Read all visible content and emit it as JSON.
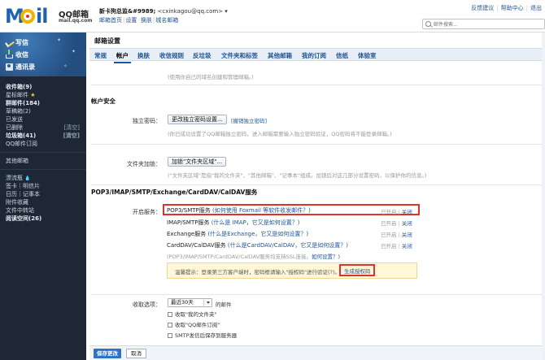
{
  "header": {
    "logo_text": "Mail",
    "logo_brand": "QQ邮箱",
    "logo_domain": "mail.qq.com",
    "user_name": "新卡狗总监&#9989;",
    "user_email": "<cxinkagou@qq.com>",
    "user_arrow": "▾",
    "links": [
      "邮箱首页",
      "设置",
      "换肤",
      "城名邮箱"
    ],
    "top_links": [
      "反馈建议",
      "帮助中心",
      "退出"
    ],
    "search_placeholder": "邮件搜索..."
  },
  "sidebar": {
    "write": "写信",
    "inbox": "收信",
    "contacts": "通讯录",
    "folders": [
      {
        "label": "收件箱(9)",
        "bold": true
      },
      {
        "label": "星标邮件",
        "star": "★"
      },
      {
        "label": "群邮件(184)",
        "bold": true
      },
      {
        "label": "草稿箱(2)"
      },
      {
        "label": "已发送"
      },
      {
        "label": "已删除",
        "clear": "[清空]"
      },
      {
        "label": "垃圾箱(41)",
        "bold": true,
        "clear": "[清空]"
      },
      {
        "label": "QQ邮件订阅"
      }
    ],
    "other_mailbox": "其他邮箱",
    "bottom_items": [
      {
        "label": "漂流瓶",
        "drop": "💧"
      },
      {
        "label": "签卡｜明信片"
      },
      {
        "label": "日历｜记事本"
      },
      {
        "label": "附件收藏"
      },
      {
        "label": "文件中转站"
      },
      {
        "label": "阅读空间(26)",
        "bold": true
      }
    ]
  },
  "main": {
    "title": "邮箱设置",
    "tabs": [
      "常规",
      "帐户",
      "换肤",
      "收信规则",
      "反垃圾",
      "文件夹和标签",
      "其他邮箱",
      "我的订阅",
      "信纸",
      "体验室"
    ],
    "active_tab": "帐户",
    "top_hint": "(使用你自己的域名创建和管理邮箱。)",
    "account_security": {
      "title": "帐户安全",
      "pw_label": "独立密码：",
      "pw_button": "更改独立密码设置...",
      "pw_link": "[撤销独立密码]",
      "pw_hint": "(你已成功设置了QQ邮箱独立密码，进入邮箱需要输入独立密码验证，QQ密码将不能登录邮箱。)"
    },
    "folder_password": {
      "label": "文件夹加锁：",
      "button": "加锁\"文件夹区域\"...",
      "hint": "(\"文件夹区域\"是指\"我的文件夹\"、\"其他邮箱\"、\"记事本\"组成。加锁后对这几部分设置密码，以保护你的信息。)"
    },
    "pop3": {
      "title": "POP3/IMAP/SMTP/Exchange/CardDAV/CalDAV服务",
      "label": "开启服务：",
      "services": [
        {
          "name": "POP3/SMTP服务",
          "help": "(如何使用 Foxmail 等软件收发邮件？)",
          "state": "已开启",
          "action": "关闭"
        },
        {
          "name": "IMAP/SMTP服务",
          "help": "(什么是 IMAP，它又是如何设置？)",
          "state": "已开启",
          "action": "关闭"
        },
        {
          "name": "Exchange服务",
          "help": "(什么是Exchange，它又是如何设置？)",
          "state": "已开启",
          "action": "关闭"
        },
        {
          "name": "CardDAV/CalDAV服务",
          "help": "(什么是CardDAV/CalDAV，它又是如何设置？)",
          "state": "已开启",
          "action": "关闭"
        }
      ],
      "ssl_hint": "(POP3/IMAP/SMTP/CardDAV/CalDAV服务均支持SSL连接。",
      "ssl_link": "如何设置？)",
      "warning_text": "温馨提示：登录第三方客户端时，密码框请输入\"授权码\"进行验证(?)。",
      "warning_link": "生成授权码"
    },
    "receive": {
      "label": "收取选项：",
      "select_value": "最近30天",
      "select_suffix": "的邮件",
      "options": [
        "收取\"我的文件夹\"",
        "收取\"QQ邮件订阅\"",
        "SMTP发信后保存到服务器"
      ]
    }
  },
  "footer": {
    "save": "保存更改",
    "cancel": "取消"
  }
}
